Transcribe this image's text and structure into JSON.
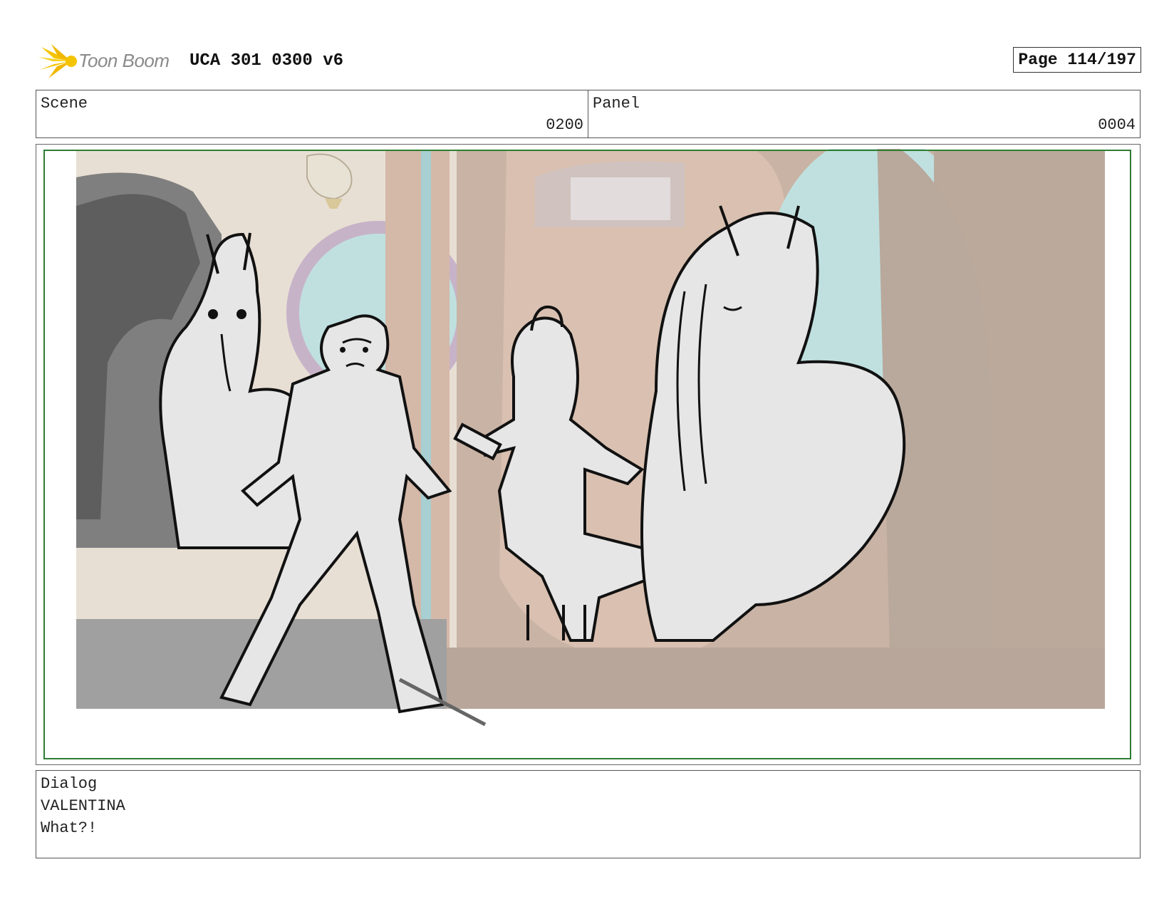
{
  "header": {
    "logo_text": "Toon Boom",
    "doc_title": "UCA 301 0300 v6",
    "page": "Page 114/197"
  },
  "info": {
    "scene_label": "Scene",
    "scene_value": "0200",
    "panel_label": "Panel",
    "panel_value": "0004"
  },
  "dialog": {
    "label": "Dialog",
    "character": "VALENTINA",
    "line": "What?!"
  },
  "colors": {
    "safe_frame": "#2e7d32",
    "bg_wall": "#d9c3b4",
    "bg_teal": "#bfe0df",
    "sketch_fill": "#e6e6e6"
  }
}
